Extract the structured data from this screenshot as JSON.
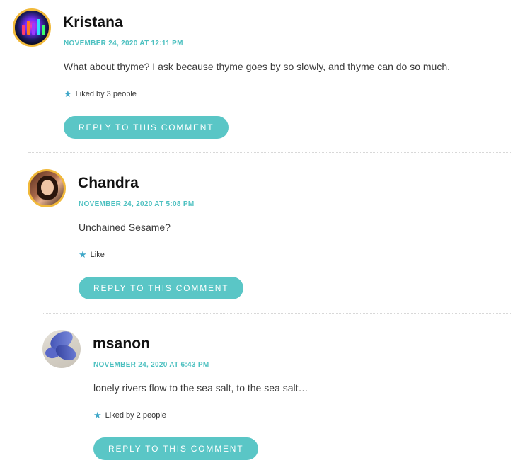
{
  "comments": [
    {
      "author": "Kristana",
      "date": "NOVEMBER 24, 2020 AT 12:11 PM",
      "text": "What about thyme? I ask because thyme goes by so slowly, and thyme can do so much.",
      "likes": "Liked by 3 people",
      "reply_label": "REPLY TO THIS COMMENT"
    },
    {
      "author": "Chandra",
      "date": "NOVEMBER 24, 2020 AT 5:08 PM",
      "text": "Unchained Sesame?",
      "likes": "Like",
      "reply_label": "REPLY TO THIS COMMENT"
    },
    {
      "author": "msanon",
      "date": "NOVEMBER 24, 2020 AT 6:43 PM",
      "text": "lonely rivers flow to the sea salt, to the sea salt…",
      "likes": "Liked by 2 people",
      "reply_label": "REPLY TO THIS COMMENT"
    }
  ],
  "icons": {
    "like": "star-icon"
  },
  "colors": {
    "accent": "#5ac6c6",
    "date": "#4cc0c0",
    "star": "#3fa7c8",
    "avatar_ring": "#f1b93a"
  }
}
